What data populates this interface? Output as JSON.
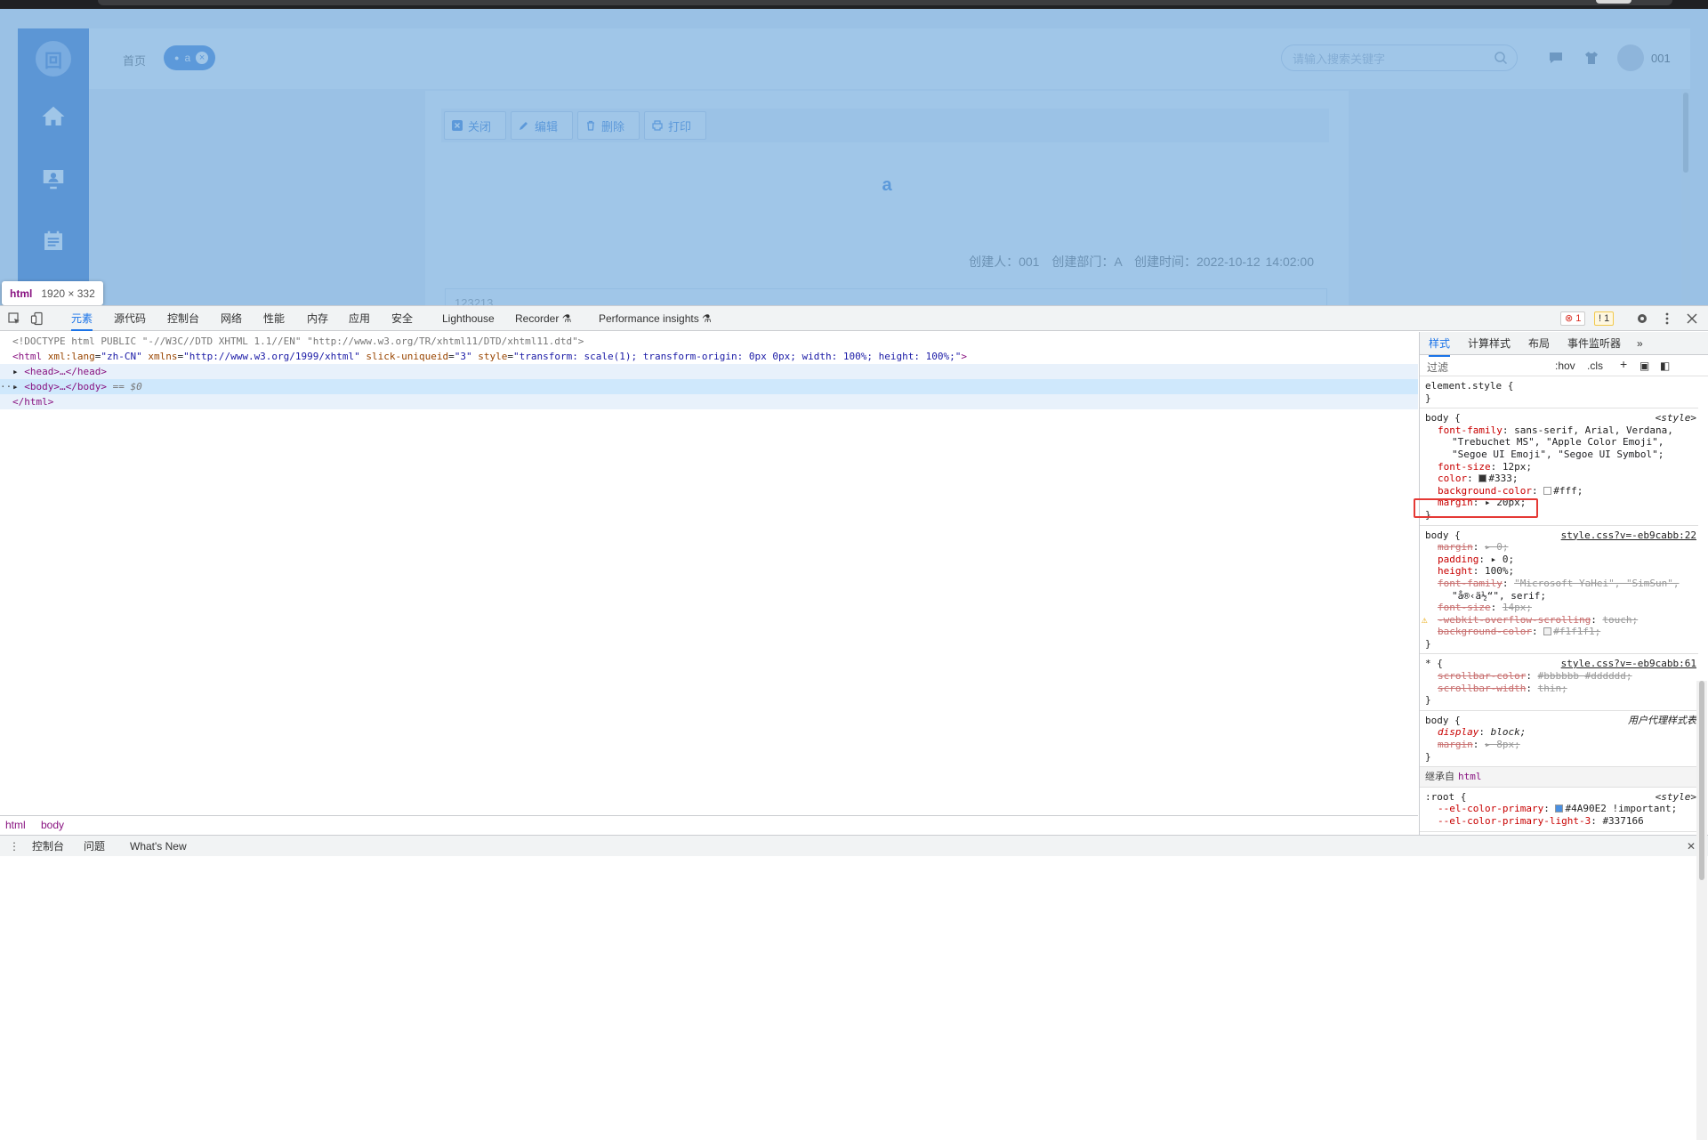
{
  "app": {
    "sidebar": {
      "logo_glyph": "回"
    },
    "header": {
      "crumb_home": "首页",
      "tag_label": "a",
      "tag_close": "×",
      "search_placeholder": "请输入搜索关键字",
      "username": "001"
    },
    "toolbar": {
      "close": "关闭",
      "edit": "编辑",
      "delete": "删除",
      "print": "打印"
    },
    "document": {
      "title": "a",
      "meta": "创建人：001　创建部门：A　创建时间：2022-10-12 14:02:00",
      "body_preview": "123213"
    },
    "colors": {
      "primary": "#3a7bd5",
      "overlay": "#6fa8dc"
    }
  },
  "tooltip": {
    "tag": "html",
    "dims": "1920 × 332"
  },
  "devtools": {
    "tabs": [
      "元素",
      "源代码",
      "控制台",
      "网络",
      "性能",
      "内存",
      "应用",
      "安全",
      "Lighthouse",
      "Recorder ⚗",
      "Performance insights ⚗"
    ],
    "active_tab": "元素",
    "error_count": "1",
    "warning_count": "1",
    "elements": {
      "doctype": "<!DOCTYPE html PUBLIC \"-//W3C//DTD XHTML 1.1//EN\" \"http://www.w3.org/TR/xhtml11/DTD/xhtml11.dtd\">",
      "html_open_tag": "html",
      "html_attrs": [
        {
          "name": "xml:lang",
          "value": "\"zh-CN\""
        },
        {
          "name": "xmlns",
          "value": "\"http://www.w3.org/1999/xhtml\""
        },
        {
          "name": "slick-uniqueid",
          "value": "\"3\""
        },
        {
          "name": "style",
          "value": "\"transform: scale(1); transform-origin: 0px 0px; width: 100%; height: 100%;\""
        }
      ],
      "head_line": "<head>…</head>",
      "body_line": "<body>…</body>",
      "body_suffix": "== $0",
      "html_close": "</html>",
      "ellipsis": "···"
    },
    "breadcrumbs": [
      "html",
      "body"
    ],
    "drawer_tabs": [
      "控制台",
      "问题",
      "What's New"
    ],
    "styles_panel": {
      "tabs": [
        "样式",
        "计算样式",
        "布局",
        "事件监听器",
        "»"
      ],
      "filter_placeholder": "过滤",
      "hov": ":hov",
      "cls": ".cls",
      "rules": [
        {
          "selector": "element.style {",
          "source": "",
          "decls": [],
          "close": "}"
        },
        {
          "selector": "body {",
          "source": "<style>",
          "decls": [
            {
              "p": "font-family",
              "v": "sans-serif, Arial, Verdana,",
              "state": "normal"
            },
            {
              "cont": "\"Trebuchet MS\", \"Apple Color Emoji\","
            },
            {
              "cont": "\"Segoe UI Emoji\", \"Segoe UI Symbol\";"
            },
            {
              "p": "font-size",
              "v": "12px;",
              "state": "normal"
            },
            {
              "p": "color",
              "v": "#333;",
              "state": "normal",
              "swatch": "#333333"
            },
            {
              "p": "background-color",
              "v": "#fff;",
              "state": "normal",
              "swatch": "#ffffff"
            },
            {
              "p": "margin",
              "v": "▸ 20px;",
              "state": "normal"
            }
          ],
          "close": "}"
        },
        {
          "selector": "body {",
          "source": "style.css?v=-eb9cabb:22",
          "decls": [
            {
              "p": "margin",
              "v": "▸ 0;",
              "state": "strike"
            },
            {
              "p": "padding",
              "v": "▸ 0;",
              "state": "normal"
            },
            {
              "p": "height",
              "v": "100%;",
              "state": "normal"
            },
            {
              "p": "font-family",
              "v": "\"Microsoft YaHei\", \"SimSun\",",
              "state": "strike"
            },
            {
              "cont": "\"å®‹ä½“\", serif;"
            },
            {
              "p": "font-size",
              "v": "14px;",
              "state": "strike"
            },
            {
              "p": "-webkit-overflow-scrolling",
              "v": "touch;",
              "state": "strike",
              "warn": "⚠"
            },
            {
              "p": "background-color",
              "v": "#f1f1f1;",
              "state": "strike",
              "swatch": "#f1f1f1"
            }
          ],
          "close": "}"
        },
        {
          "selector": "* {",
          "source": "style.css?v=-eb9cabb:61",
          "decls": [
            {
              "p": "scrollbar-color",
              "v": "#bbbbbb #dddddd;",
              "state": "strike"
            },
            {
              "p": "scrollbar-width",
              "v": "thin;",
              "state": "strike"
            }
          ],
          "close": "}"
        },
        {
          "selector": "body {",
          "source": "用户代理样式表",
          "decls": [
            {
              "p": "display",
              "v": "block;",
              "state": "italic"
            },
            {
              "p": "margin",
              "v": "▸ 8px;",
              "state": "strike"
            }
          ],
          "close": "}"
        }
      ],
      "inherited_from_label": "继承自",
      "inherited_from_tag": "html",
      "root_rule": {
        "selector": ":root {",
        "source": "<style>",
        "decl_p": "--el-color-primary",
        "decl_v": "#4A90E2 !important;",
        "swatch": "#4A90E2",
        "next_p": "--el-color-primary-light-3",
        "next_v": "#337166"
      }
    }
  }
}
